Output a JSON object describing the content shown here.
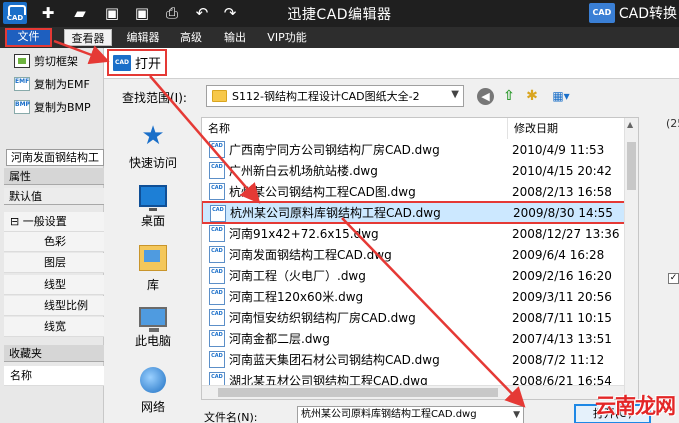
{
  "app": {
    "title": "迅捷CAD编辑器",
    "logo_text": "CAD",
    "convert_badge": "CAD",
    "convert_label": "CAD转换"
  },
  "menu": {
    "file": "文件",
    "viewer": "查看器",
    "items": [
      "编辑器",
      "高级",
      "输出",
      "VIP功能"
    ]
  },
  "left_menu": {
    "crop": "剪切框架",
    "copy_emf": "复制为EMF",
    "copy_bmp": "复制为BMP",
    "emf_icon_text": "EMF",
    "bmp_icon_text": "BMP"
  },
  "doc_tab": "河南发面钢结构工",
  "properties": {
    "header": "属性",
    "default": "默认值",
    "group": "一般设置",
    "rows": [
      "色彩",
      "图层",
      "线型",
      "线型比例",
      "线宽"
    ]
  },
  "favorites": {
    "header": "收藏夹",
    "name_col": "名称"
  },
  "dialog": {
    "title": "打开",
    "icon_text": "CAD",
    "lookin_label": "查找范围(I):",
    "lookin_value": "S112-钢结构工程设计CAD图纸大全-2",
    "places": [
      "快速访问",
      "桌面",
      "库",
      "此电脑",
      "网络"
    ],
    "col_name": "名称",
    "col_date": "修改日期",
    "file_icon_text": "CAD",
    "files": [
      {
        "name": "广西南宁同方公司钢结构厂房CAD.dwg",
        "date": "2010/4/9 11:53"
      },
      {
        "name": "广州新白云机场航站楼.dwg",
        "date": "2010/4/15 20:42"
      },
      {
        "name": "杭州某公司钢结构工程CAD图.dwg",
        "date": "2008/2/13 16:58"
      },
      {
        "name": "杭州某公司原料库钢结构工程CAD.dwg",
        "date": "2009/8/30 14:55"
      },
      {
        "name": "河南91x42+72.6x15.dwg",
        "date": "2008/12/27 13:36"
      },
      {
        "name": "河南发面钢结构工程CAD.dwg",
        "date": "2009/6/4 16:28"
      },
      {
        "name": "河南工程（火电厂）.dwg",
        "date": "2009/2/16 16:20"
      },
      {
        "name": "河南工程120x60米.dwg",
        "date": "2009/3/11 20:56"
      },
      {
        "name": "河南恒安纺织钢结构厂房CAD.dwg",
        "date": "2008/7/11 10:15"
      },
      {
        "name": "河南金都二层.dwg",
        "date": "2007/4/13 13:51"
      },
      {
        "name": "河南蓝天集团石材公司钢结构CAD.dwg",
        "date": "2008/7/2 11:12"
      },
      {
        "name": "湖北某五材公司钢结构工程CAD.dwg",
        "date": "2008/6/21 16:54"
      }
    ],
    "filename_label": "文件名(N):",
    "filename_value": "杭州某公司原料库钢结构工程CAD.dwg",
    "open_button": "打开(O)",
    "right_num": "(25"
  },
  "watermark": "云南龙网",
  "colors": {
    "annotation": "#e53935",
    "accent": "#1e88e5",
    "selection": "#cce8ff"
  }
}
